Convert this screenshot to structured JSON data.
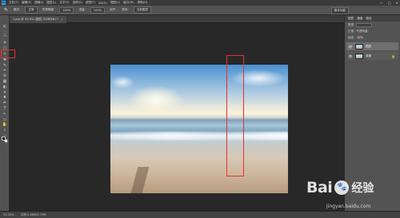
{
  "app": {
    "icon_text": "Ps"
  },
  "menubar": {
    "items": [
      "文件(F)",
      "编辑(E)",
      "图像(I)",
      "图层(L)",
      "文字(Y)",
      "选择(S)",
      "滤镜(T)",
      "3D(D)",
      "视图(V)",
      "窗口(W)",
      "帮助(H)"
    ],
    "window_controls": [
      "—",
      "□",
      "✕"
    ]
  },
  "options": {
    "tool_glyph": "✎",
    "items": [
      "模式:",
      "正常",
      "不透明度:",
      "100%",
      "流量:",
      "100%",
      "对齐",
      "样本:",
      "当前图层"
    ],
    "right": [
      "基本功能"
    ]
  },
  "document": {
    "tab_label": "1.jpg @ 33.3% (图层, RGB/8#) *",
    "close": "×"
  },
  "tools": [
    "⇱",
    "⬚",
    "⌒",
    "⌗",
    "⬡",
    "✑",
    "✚",
    "✎",
    "⌖",
    "⊘",
    "▦",
    "◐",
    "✦",
    "♦",
    "✒",
    "T",
    "↖",
    "▭",
    "✋",
    "⌕",
    "⋯"
  ],
  "panel": {
    "tabs": [
      "图层",
      "通道",
      "路径"
    ],
    "kind_label": "类型",
    "mode_label": "正常",
    "opacity_label": "不透明度:",
    "lock_label": "锁定:",
    "fill_label": "填充:",
    "layers": [
      {
        "name": "图层",
        "locked": false
      },
      {
        "name": "背景",
        "locked": true
      }
    ]
  },
  "status": {
    "zoom": "33.33%",
    "doc_info": "文档:2.86M/5.73M"
  },
  "watermark": {
    "logo_left": "Bai",
    "paw": "🐾",
    "logo_right": "经验",
    "url": "jingyan.baidu.com"
  }
}
